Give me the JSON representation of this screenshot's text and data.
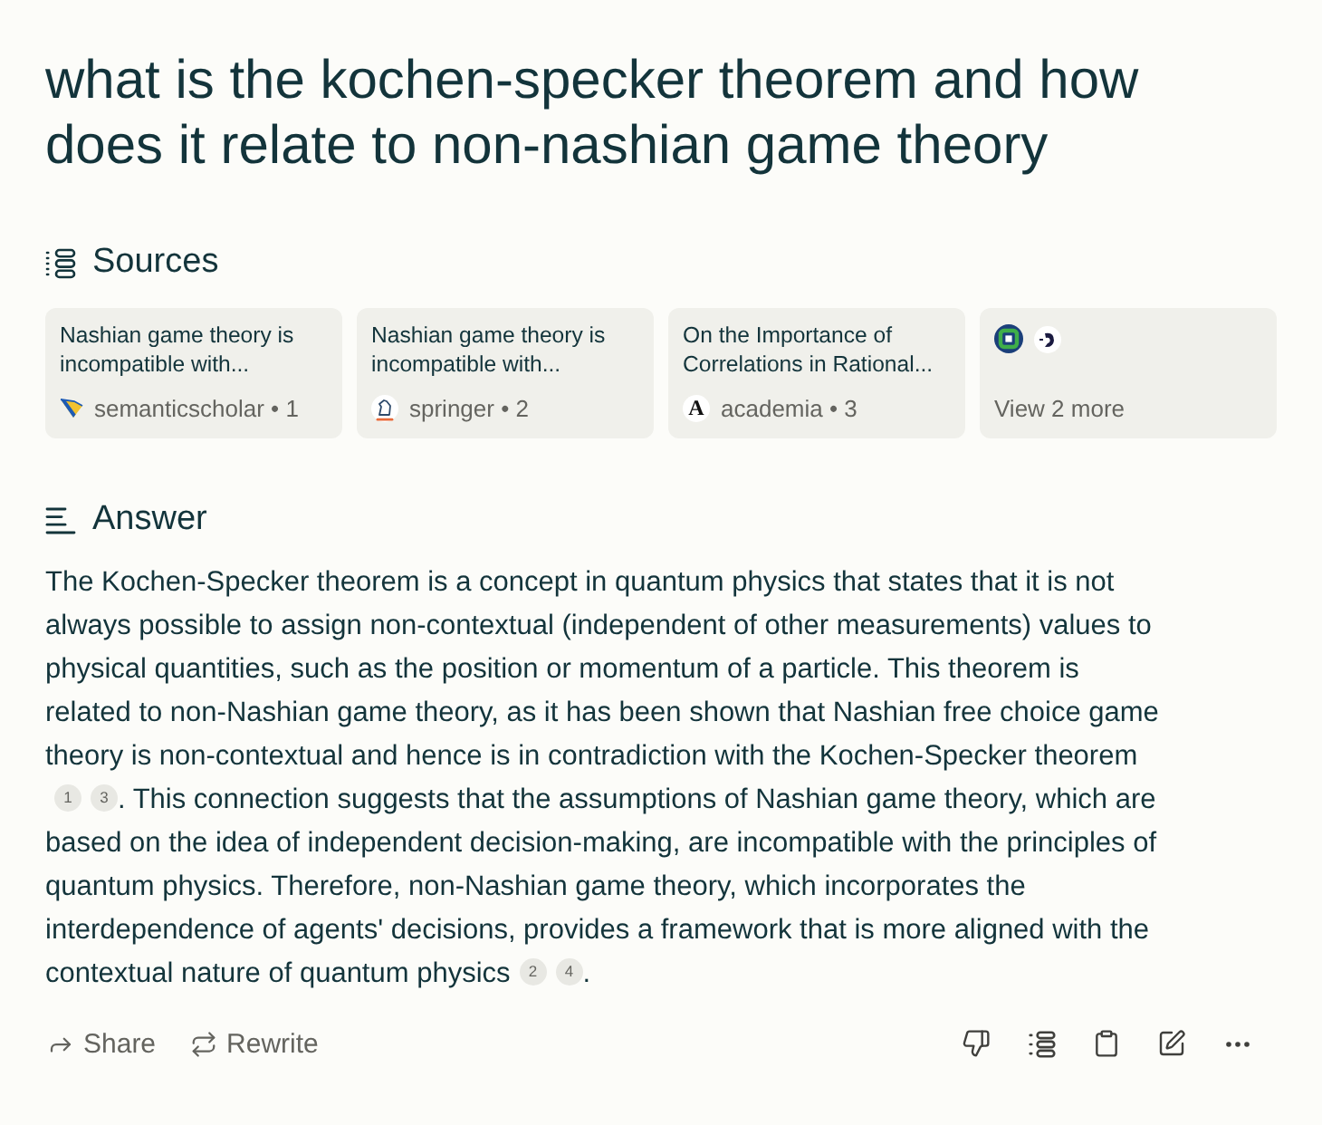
{
  "query": "what is the kochen-specker theorem and how does it relate to non-nashian game theory",
  "sources": {
    "heading": "Sources",
    "items": [
      {
        "title": "Nashian game theory is incompatible with...",
        "label": "semanticscholar • 1"
      },
      {
        "title": "Nashian game theory is incompatible with...",
        "label": "springer • 2"
      },
      {
        "title": "On the Importance of Correlations in Rational...",
        "label": "academia • 3",
        "logo_letter": "A"
      }
    ],
    "more": {
      "label": "View 2 more"
    }
  },
  "answer": {
    "heading": "Answer",
    "lines": [
      [
        {
          "kind": "text",
          "text": "The Kochen-Specker theorem is a concept in quantum physics that states that it is not"
        }
      ],
      [
        {
          "kind": "text",
          "text": "always possible to assign non-contextual (independent of other measurements) values to"
        }
      ],
      [
        {
          "kind": "text",
          "text": "physical quantities, such as the position or momentum of a particle. This theorem is"
        }
      ],
      [
        {
          "kind": "text",
          "text": "related to non-Nashian game theory, as it has been shown that Nashian free choice game"
        }
      ],
      [
        {
          "kind": "text",
          "text": "theory is non-contextual and hence is in contradiction with the Kochen-Specker theorem"
        }
      ],
      [
        {
          "kind": "cite",
          "text": "1"
        },
        {
          "kind": "cite",
          "text": "3"
        },
        {
          "kind": "text",
          "text": ". This connection suggests that the assumptions of Nashian game theory, which are"
        }
      ],
      [
        {
          "kind": "text",
          "text": "based on the idea of independent decision-making, are incompatible with the principles of"
        }
      ],
      [
        {
          "kind": "text",
          "text": "quantum physics. Therefore, non-Nashian game theory, which incorporates the"
        }
      ],
      [
        {
          "kind": "text",
          "text": "interdependence of agents' decisions, provides a framework that is more aligned with the"
        }
      ],
      [
        {
          "kind": "text",
          "text": "contextual nature of quantum physics"
        },
        {
          "kind": "cite",
          "text": "2"
        },
        {
          "kind": "cite",
          "text": "4"
        },
        {
          "kind": "text",
          "text": "."
        }
      ]
    ]
  },
  "actions": [
    {
      "label": "Share"
    },
    {
      "label": "Rewrite"
    }
  ]
}
